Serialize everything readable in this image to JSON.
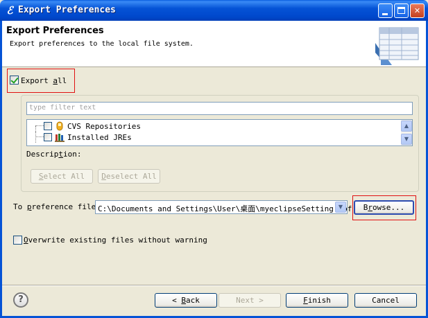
{
  "window": {
    "title": "Export Preferences",
    "app_icon": "eclipse-logo-icon"
  },
  "header": {
    "title": "Export Preferences",
    "description": "Export preferences to the local file system."
  },
  "export_all": {
    "label_pre": "Export ",
    "label_u": "a",
    "label_post": "ll",
    "checked": true
  },
  "filter": {
    "placeholder": "type filter text",
    "value": ""
  },
  "tree": {
    "items": [
      {
        "label": "CVS Repositories",
        "checked": false,
        "icon": "cvs-repository-icon"
      },
      {
        "label": "Installed JREs",
        "checked": false,
        "icon": "jre-library-icon"
      }
    ]
  },
  "description_label_pre": "Descrip",
  "description_label_u": "t",
  "description_label_post": "ion:",
  "select_all": {
    "u": "S",
    "rest": "elect All",
    "enabled": false
  },
  "deselect_all": {
    "u": "D",
    "rest": "eselect All",
    "enabled": false
  },
  "preference_file": {
    "label_pre": "To ",
    "label_u": "p",
    "label_post": "reference file:",
    "value": "C:\\Documents and Settings\\User\\桌面\\myeclipseSetting.epf"
  },
  "browse": {
    "label_pre": "B",
    "label_u": "r",
    "label_post": "owse..."
  },
  "overwrite": {
    "label_u": "O",
    "label_post": "verwrite existing files without warning",
    "checked": false
  },
  "footer": {
    "back": {
      "pre": "< ",
      "u": "B",
      "post": "ack"
    },
    "next": {
      "label": "Next >",
      "enabled": false
    },
    "finish": {
      "u": "F",
      "post": "inish"
    },
    "cancel": {
      "label": "Cancel"
    }
  }
}
